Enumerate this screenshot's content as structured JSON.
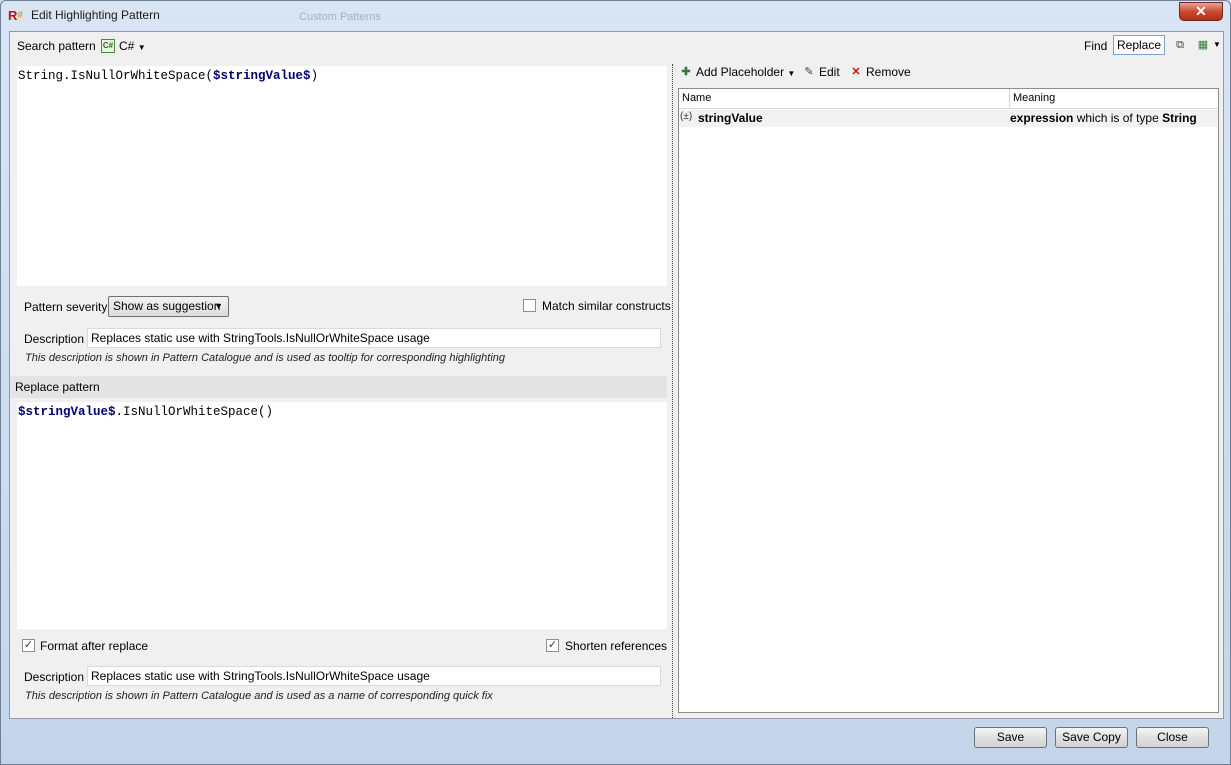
{
  "window": {
    "title": "Edit Highlighting Pattern",
    "background_title": "Custom Patterns",
    "close_glyph": "✕"
  },
  "search": {
    "label": "Search pattern",
    "language": "C#",
    "pattern_parts": [
      {
        "text": "String.IsNullOrWhiteSpace(",
        "placeholder": false
      },
      {
        "text": "$stringValue$",
        "placeholder": true
      },
      {
        "text": ")",
        "placeholder": false
      }
    ],
    "severity_label": "Pattern severity",
    "severity_value": "Show as suggestion",
    "match_similar_label": "Match similar constructs",
    "match_similar_checked": false,
    "description_label": "Description",
    "description_value": "Replaces static use with StringTools.IsNullOrWhiteSpace usage",
    "description_hint": "This description is shown in Pattern Catalogue and is used as tooltip for corresponding highlighting"
  },
  "mode": {
    "find_label": "Find",
    "replace_label": "Replace",
    "active": "Replace"
  },
  "replace": {
    "label": "Replace pattern",
    "pattern_parts": [
      {
        "text": "$stringValue$",
        "placeholder": true
      },
      {
        "text": ".IsNullOrWhiteSpace()",
        "placeholder": false
      }
    ],
    "format_label": "Format after replace",
    "format_checked": true,
    "shorten_label": "Shorten references",
    "shorten_checked": true,
    "description_label": "Description",
    "description_value": "Replaces static use with StringTools.IsNullOrWhiteSpace usage",
    "description_hint": "This description is shown in Pattern Catalogue and is used as a name of corresponding quick fix"
  },
  "placeholders": {
    "toolbar": {
      "add_label": "Add Placeholder",
      "edit_label": "Edit",
      "remove_label": "Remove"
    },
    "columns": {
      "name": "Name",
      "meaning": "Meaning"
    },
    "rows": [
      {
        "icon_text": "(±)",
        "name": "stringValue",
        "meaning_kind": "expression",
        "meaning_mid": " which is of type ",
        "meaning_type": "String"
      }
    ]
  },
  "buttons": {
    "save": "Save",
    "save_copy": "Save Copy",
    "close": "Close"
  },
  "colors": {
    "placeholder": "#00006e",
    "accent": "#7da2ce"
  }
}
